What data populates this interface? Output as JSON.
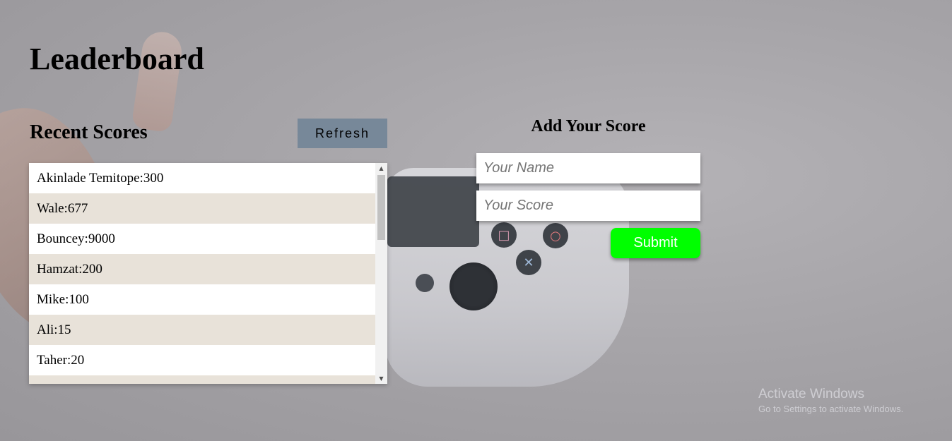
{
  "page": {
    "title": "Leaderboard"
  },
  "recent_scores": {
    "heading": "Recent Scores",
    "refresh_label": "Refresh",
    "items": [
      {
        "label": "Akinlade Temitope:300"
      },
      {
        "label": "Wale:677"
      },
      {
        "label": "Bouncey:9000"
      },
      {
        "label": "Hamzat:200"
      },
      {
        "label": "Mike:100"
      },
      {
        "label": "Ali:15"
      },
      {
        "label": "Taher:20"
      },
      {
        "label": ""
      }
    ]
  },
  "add_score": {
    "heading": "Add Your Score",
    "name_placeholder": "Your Name",
    "name_value": "",
    "score_placeholder": "Your Score",
    "score_value": "",
    "submit_label": "Submit"
  },
  "watermark": {
    "title": "Activate Windows",
    "subtitle": "Go to Settings to activate Windows."
  },
  "colors": {
    "refresh_button": "#778899",
    "submit_button": "#00ff00",
    "alt_row": "#e8e2d9"
  }
}
